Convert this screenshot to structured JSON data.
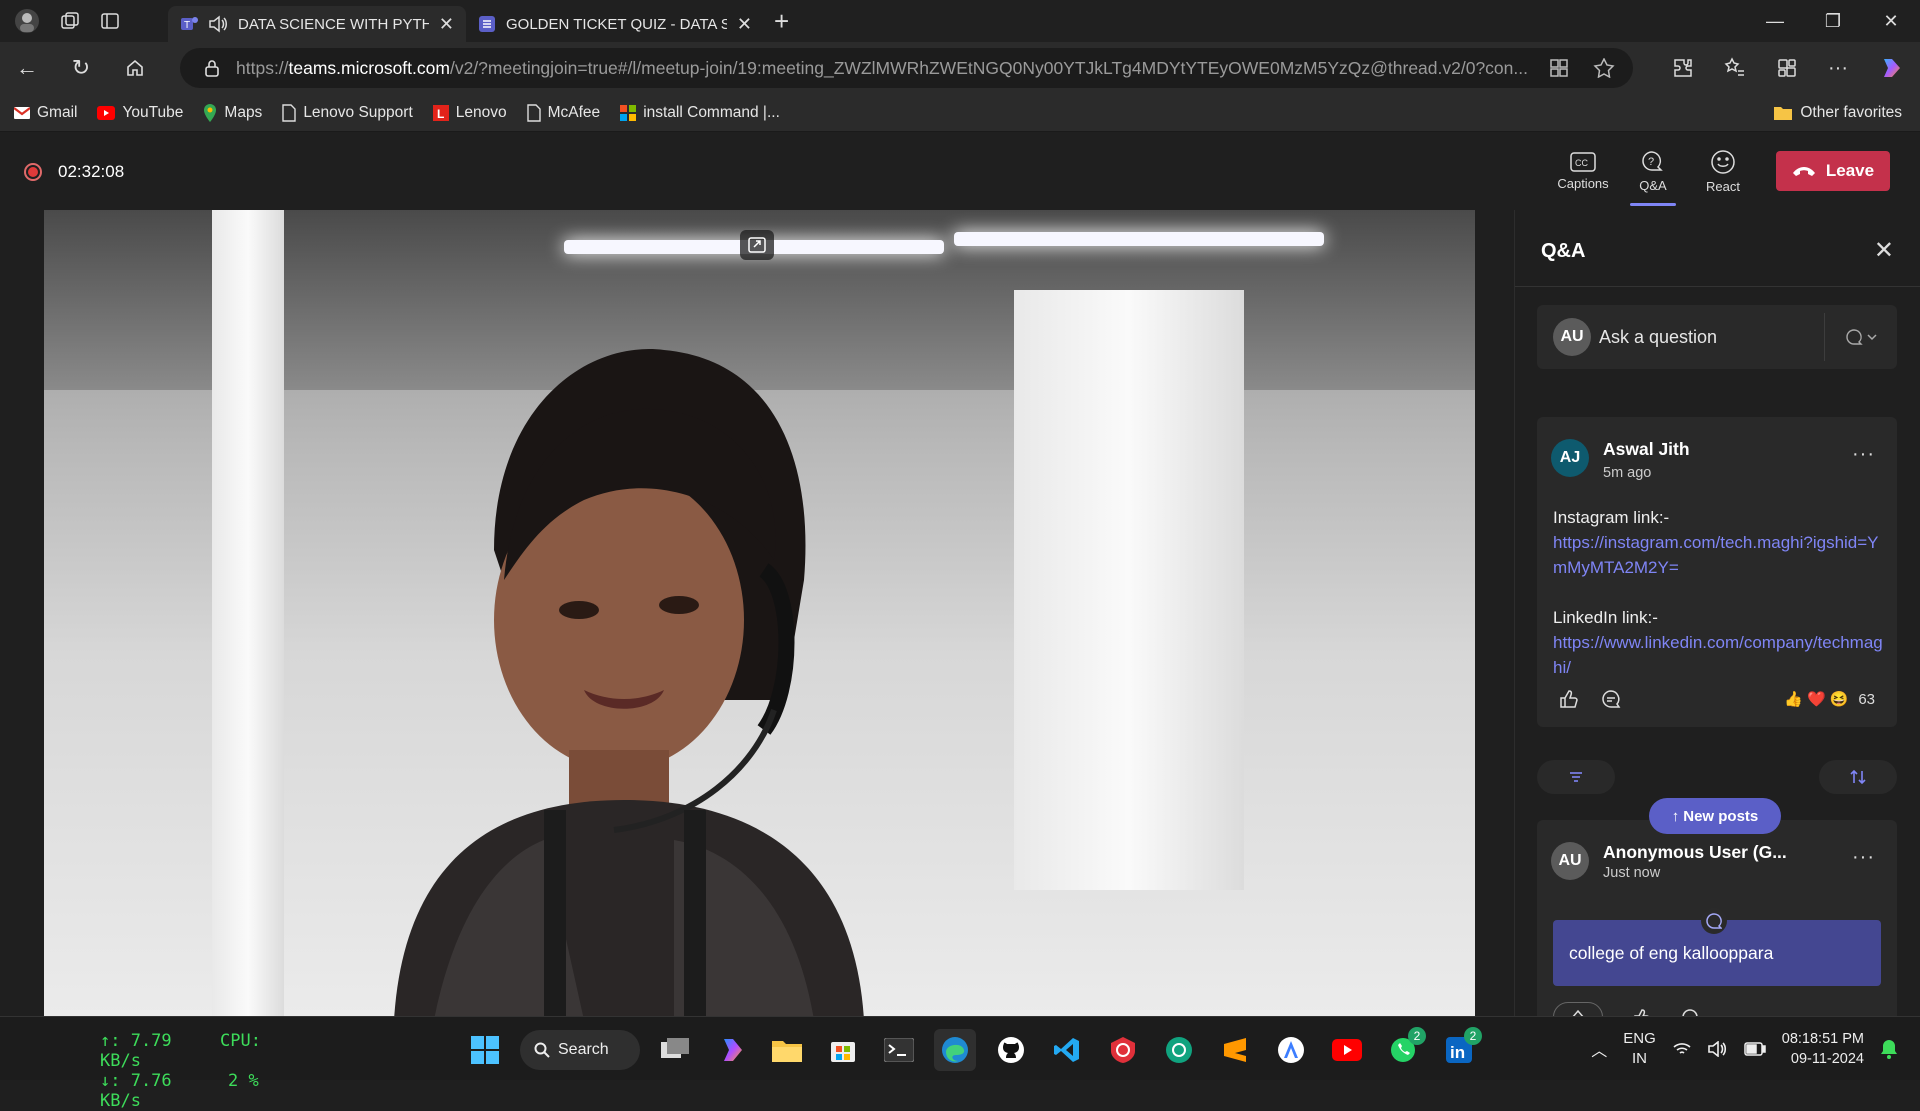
{
  "browser": {
    "tabs": [
      {
        "title": "DATA SCIENCE WITH PYTHON",
        "active": true
      },
      {
        "title": "GOLDEN TICKET QUIZ - DATA SCIENCE",
        "active": false
      }
    ],
    "url_prefix": "https://",
    "url_host": "teams.microsoft.com",
    "url_rest": "/v2/?meetingjoin=true#/l/meetup-join/19:meeting_ZWZlMWRhZWEtNGQ0Ny00YTJkLTg4MDYtYTEyOWE0MzM5YzQz@thread.v2/0?con...",
    "favorites": [
      "Gmail",
      "YouTube",
      "Maps",
      "Lenovo Support",
      "Lenovo",
      "McAfee",
      "install Command |..."
    ],
    "other_favorites": "Other favorites"
  },
  "meeting": {
    "timer": "02:32:08",
    "actions": [
      {
        "label": "Captions",
        "icon": "captions-icon"
      },
      {
        "label": "Q&A",
        "icon": "qa-icon"
      },
      {
        "label": "React",
        "icon": "react-icon"
      }
    ],
    "leave_label": "Leave"
  },
  "qa": {
    "title": "Q&A",
    "ask_placeholder": "Ask a question",
    "ask_initials": "AU",
    "posts": [
      {
        "initials": "AJ",
        "author": "Aswal Jith",
        "time": "5m ago",
        "instagram_label": "Instagram link:-",
        "instagram_url": "https://instagram.com/tech.maghi?igshid=YmMyMTA2M2Y=",
        "linkedin_label": "LinkedIn link:-",
        "linkedin_url": "https://www.linkedin.com/company/techmaghi/",
        "reaction_count": "63"
      },
      {
        "initials": "AU",
        "author": "Anonymous User (G...",
        "time": "Just now",
        "text": "college of eng kallooppara"
      }
    ],
    "new_posts_label": "New posts"
  },
  "taskbar": {
    "net_up": "↑: 7.79 KB/s",
    "net_down": "↓: 7.76 KB/s",
    "cpu_label": "CPU:",
    "cpu_value": "2 %",
    "search_label": "Search",
    "whatsapp_badge": "2",
    "linkedin_badge": "2",
    "lang1": "ENG",
    "lang2": "IN",
    "time": "08:18:51 PM",
    "date": "09-11-2024"
  },
  "colors": {
    "accent": "#7f85f5",
    "leave": "#c4314b",
    "new_posts": "#5b5fc7",
    "bubble": "#444791",
    "netstat": "#3ddc5a"
  }
}
